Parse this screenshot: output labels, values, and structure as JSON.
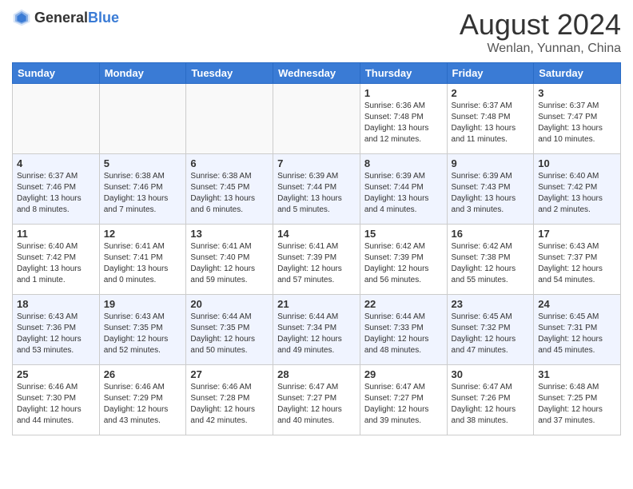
{
  "header": {
    "logo_general": "General",
    "logo_blue": "Blue",
    "month_year": "August 2024",
    "location": "Wenlan, Yunnan, China"
  },
  "days_of_week": [
    "Sunday",
    "Monday",
    "Tuesday",
    "Wednesday",
    "Thursday",
    "Friday",
    "Saturday"
  ],
  "weeks": [
    [
      {
        "day": "",
        "info": ""
      },
      {
        "day": "",
        "info": ""
      },
      {
        "day": "",
        "info": ""
      },
      {
        "day": "",
        "info": ""
      },
      {
        "day": "1",
        "info": "Sunrise: 6:36 AM\nSunset: 7:48 PM\nDaylight: 13 hours\nand 12 minutes."
      },
      {
        "day": "2",
        "info": "Sunrise: 6:37 AM\nSunset: 7:48 PM\nDaylight: 13 hours\nand 11 minutes."
      },
      {
        "day": "3",
        "info": "Sunrise: 6:37 AM\nSunset: 7:47 PM\nDaylight: 13 hours\nand 10 minutes."
      }
    ],
    [
      {
        "day": "4",
        "info": "Sunrise: 6:37 AM\nSunset: 7:46 PM\nDaylight: 13 hours\nand 8 minutes."
      },
      {
        "day": "5",
        "info": "Sunrise: 6:38 AM\nSunset: 7:46 PM\nDaylight: 13 hours\nand 7 minutes."
      },
      {
        "day": "6",
        "info": "Sunrise: 6:38 AM\nSunset: 7:45 PM\nDaylight: 13 hours\nand 6 minutes."
      },
      {
        "day": "7",
        "info": "Sunrise: 6:39 AM\nSunset: 7:44 PM\nDaylight: 13 hours\nand 5 minutes."
      },
      {
        "day": "8",
        "info": "Sunrise: 6:39 AM\nSunset: 7:44 PM\nDaylight: 13 hours\nand 4 minutes."
      },
      {
        "day": "9",
        "info": "Sunrise: 6:39 AM\nSunset: 7:43 PM\nDaylight: 13 hours\nand 3 minutes."
      },
      {
        "day": "10",
        "info": "Sunrise: 6:40 AM\nSunset: 7:42 PM\nDaylight: 13 hours\nand 2 minutes."
      }
    ],
    [
      {
        "day": "11",
        "info": "Sunrise: 6:40 AM\nSunset: 7:42 PM\nDaylight: 13 hours\nand 1 minute."
      },
      {
        "day": "12",
        "info": "Sunrise: 6:41 AM\nSunset: 7:41 PM\nDaylight: 13 hours\nand 0 minutes."
      },
      {
        "day": "13",
        "info": "Sunrise: 6:41 AM\nSunset: 7:40 PM\nDaylight: 12 hours\nand 59 minutes."
      },
      {
        "day": "14",
        "info": "Sunrise: 6:41 AM\nSunset: 7:39 PM\nDaylight: 12 hours\nand 57 minutes."
      },
      {
        "day": "15",
        "info": "Sunrise: 6:42 AM\nSunset: 7:39 PM\nDaylight: 12 hours\nand 56 minutes."
      },
      {
        "day": "16",
        "info": "Sunrise: 6:42 AM\nSunset: 7:38 PM\nDaylight: 12 hours\nand 55 minutes."
      },
      {
        "day": "17",
        "info": "Sunrise: 6:43 AM\nSunset: 7:37 PM\nDaylight: 12 hours\nand 54 minutes."
      }
    ],
    [
      {
        "day": "18",
        "info": "Sunrise: 6:43 AM\nSunset: 7:36 PM\nDaylight: 12 hours\nand 53 minutes."
      },
      {
        "day": "19",
        "info": "Sunrise: 6:43 AM\nSunset: 7:35 PM\nDaylight: 12 hours\nand 52 minutes."
      },
      {
        "day": "20",
        "info": "Sunrise: 6:44 AM\nSunset: 7:35 PM\nDaylight: 12 hours\nand 50 minutes."
      },
      {
        "day": "21",
        "info": "Sunrise: 6:44 AM\nSunset: 7:34 PM\nDaylight: 12 hours\nand 49 minutes."
      },
      {
        "day": "22",
        "info": "Sunrise: 6:44 AM\nSunset: 7:33 PM\nDaylight: 12 hours\nand 48 minutes."
      },
      {
        "day": "23",
        "info": "Sunrise: 6:45 AM\nSunset: 7:32 PM\nDaylight: 12 hours\nand 47 minutes."
      },
      {
        "day": "24",
        "info": "Sunrise: 6:45 AM\nSunset: 7:31 PM\nDaylight: 12 hours\nand 45 minutes."
      }
    ],
    [
      {
        "day": "25",
        "info": "Sunrise: 6:46 AM\nSunset: 7:30 PM\nDaylight: 12 hours\nand 44 minutes."
      },
      {
        "day": "26",
        "info": "Sunrise: 6:46 AM\nSunset: 7:29 PM\nDaylight: 12 hours\nand 43 minutes."
      },
      {
        "day": "27",
        "info": "Sunrise: 6:46 AM\nSunset: 7:28 PM\nDaylight: 12 hours\nand 42 minutes."
      },
      {
        "day": "28",
        "info": "Sunrise: 6:47 AM\nSunset: 7:27 PM\nDaylight: 12 hours\nand 40 minutes."
      },
      {
        "day": "29",
        "info": "Sunrise: 6:47 AM\nSunset: 7:27 PM\nDaylight: 12 hours\nand 39 minutes."
      },
      {
        "day": "30",
        "info": "Sunrise: 6:47 AM\nSunset: 7:26 PM\nDaylight: 12 hours\nand 38 minutes."
      },
      {
        "day": "31",
        "info": "Sunrise: 6:48 AM\nSunset: 7:25 PM\nDaylight: 12 hours\nand 37 minutes."
      }
    ]
  ]
}
